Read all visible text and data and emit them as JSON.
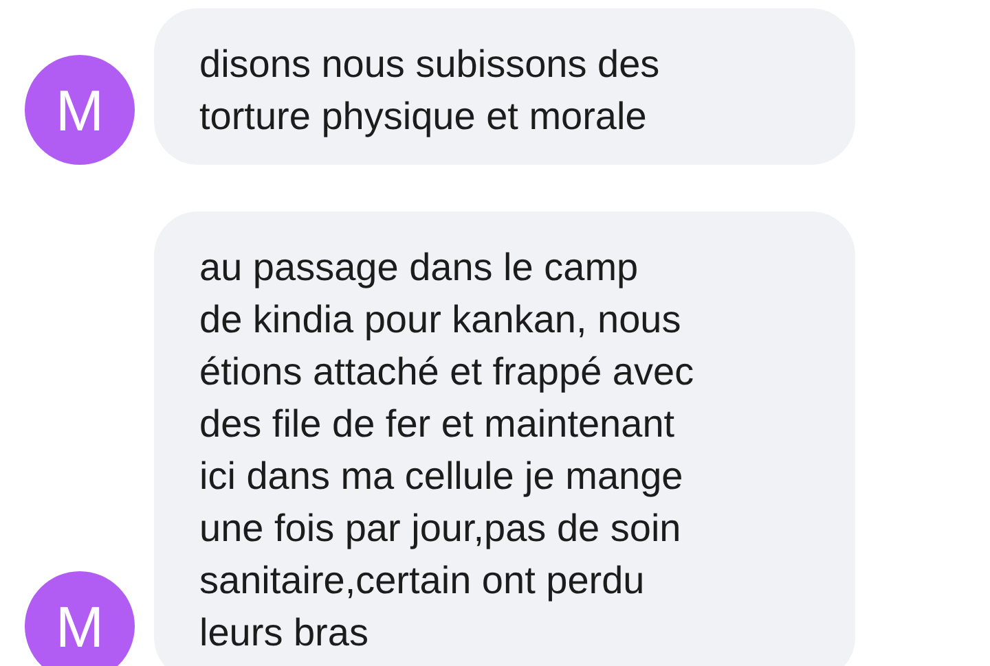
{
  "messages": [
    {
      "avatar": "M",
      "lines": [
        "disons nous subissons des",
        "torture physique et morale"
      ]
    },
    {
      "avatar": "M",
      "lines": [
        "au passage dans le camp",
        "de kindia pour kankan, nous",
        "étions attaché et frappé avec",
        "des file de fer et maintenant",
        "ici dans ma cellule je mange",
        "une fois par jour,pas de soin",
        "sanitaire,certain ont perdu",
        "leurs bras"
      ]
    }
  ]
}
